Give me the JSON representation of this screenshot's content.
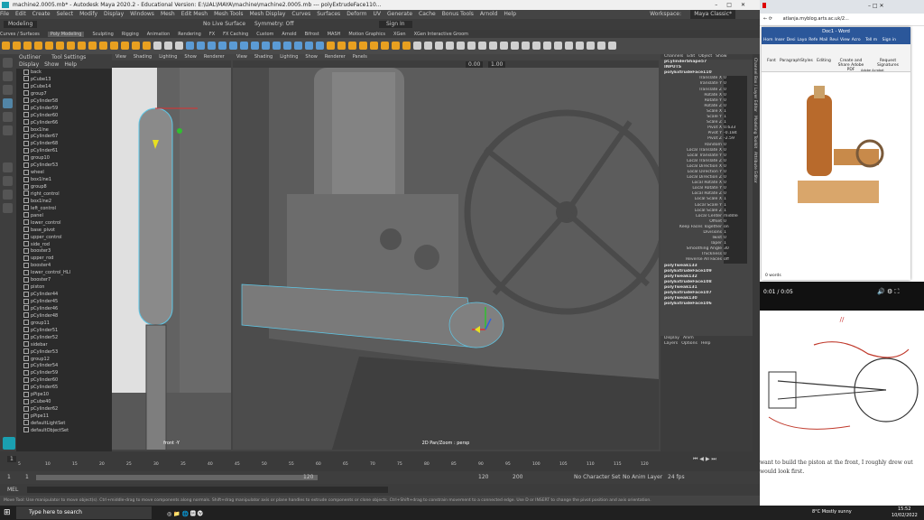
{
  "maya": {
    "title": "machine2.0005.mb* - Autodesk Maya 2020.2 - Educational Version: E:\\UAL\\MAYA\\machine\\machine2.0005.mb --- polyExtrudeFace110...",
    "menus": [
      "File",
      "Edit",
      "Create",
      "Select",
      "Modify",
      "Display",
      "Windows",
      "Mesh",
      "Edit Mesh",
      "Mesh Tools",
      "Mesh Display",
      "Curves",
      "Surfaces",
      "Deform",
      "UV",
      "Generate",
      "Cache",
      "Bonus Tools",
      "Arnold",
      "Help"
    ],
    "workspace_label": "Workspace:",
    "workspace_value": "Maya Classic*",
    "mode": "Modeling",
    "no_live_surface": "No Live Surface",
    "symmetry": "Symmetry: Off",
    "sign_in": "Sign In",
    "shelf_tabs": [
      "Curves / Surfaces",
      "Poly Modeling",
      "Sculpting",
      "Rigging",
      "Animation",
      "Rendering",
      "FX",
      "FX Caching",
      "Custom",
      "Arnold",
      "Bifrost",
      "MASH",
      "Motion Graphics",
      "XGen",
      "XGen Interactive Groom"
    ],
    "outliner": {
      "title": "Outliner",
      "tab2": "Tool Settings",
      "menu": [
        "Display",
        "Show",
        "Help"
      ],
      "items": [
        "back",
        "pCube13",
        "pCube14",
        "group7",
        "pCylinder58",
        "pCylinder59",
        "pCylinder60",
        "pCylinder66",
        "box1lne",
        "pCylinder67",
        "pCylinder68",
        "pCylinder61",
        "group10",
        "pCylinder53",
        "wheel",
        "box1lne1",
        "group8",
        "right_control",
        "box1lne2",
        "left_control",
        "panel",
        "lower_control",
        "base_pivot",
        "upper_control",
        "side_rod",
        "booster3",
        "upper_rod",
        "booster4",
        "lower_control_HLI",
        "booster7",
        "piston",
        "pCylinder44",
        "pCylinder45",
        "pCylinder46",
        "pCylinder48",
        "group11",
        "pCylinder51",
        "pCylinder52",
        "sidebar",
        "pCylinder53",
        "group12",
        "pCylinder54",
        "pCylinder59",
        "pCylinder60",
        "pCylinder65",
        "pPipe10",
        "pCube40",
        "pCylinder62",
        "pPipe11",
        "defaultLightSet",
        "defaultObjectSet"
      ]
    },
    "viewport_menu": [
      "View",
      "Shading",
      "Lighting",
      "Show",
      "Renderer",
      "Panels"
    ],
    "vp1_label": "front -Y",
    "vp2_label": "2D Pan/Zoom : persp",
    "vp2_values": [
      "0.00",
      "1.00"
    ],
    "channel_box": {
      "menu": [
        "Channels",
        "Edit",
        "Object",
        "Show"
      ],
      "object": "pCylinderShape57",
      "inputs_label": "INPUTS",
      "inputs_node": "polyExtrudeFace110",
      "attrs": [
        {
          "label": "Translate X",
          "value": "0"
        },
        {
          "label": "Translate Y",
          "value": "0"
        },
        {
          "label": "Translate Z",
          "value": "0"
        },
        {
          "label": "Rotate X",
          "value": "0"
        },
        {
          "label": "Rotate Y",
          "value": "0"
        },
        {
          "label": "Rotate Z",
          "value": "0"
        },
        {
          "label": "Scale X",
          "value": "1"
        },
        {
          "label": "Scale Y",
          "value": "1"
        },
        {
          "label": "Scale Z",
          "value": "1"
        },
        {
          "label": "Pivot X",
          "value": "0.633"
        },
        {
          "label": "Pivot Y",
          "value": "-0.184"
        },
        {
          "label": "Pivot Z",
          "value": "-2.59"
        },
        {
          "label": "Random",
          "value": "0"
        },
        {
          "label": "Local Translate X",
          "value": "0"
        },
        {
          "label": "Local Translate Y",
          "value": "0"
        },
        {
          "label": "Local Translate Z",
          "value": "0"
        },
        {
          "label": "Local Direction X",
          "value": "0"
        },
        {
          "label": "Local Direction Y",
          "value": "0"
        },
        {
          "label": "Local Direction Z",
          "value": "0"
        },
        {
          "label": "Local Rotate X",
          "value": "0"
        },
        {
          "label": "Local Rotate Y",
          "value": "0"
        },
        {
          "label": "Local Rotate Z",
          "value": "0"
        },
        {
          "label": "Local Scale X",
          "value": "1"
        },
        {
          "label": "Local Scale Y",
          "value": "1"
        },
        {
          "label": "Local Scale Z",
          "value": "1"
        },
        {
          "label": "Local Center",
          "value": "middle"
        },
        {
          "label": "Offset",
          "value": "0"
        },
        {
          "label": "Keep Faces Together",
          "value": "on"
        },
        {
          "label": "Divisions",
          "value": "1"
        },
        {
          "label": "Twist",
          "value": "0"
        },
        {
          "label": "Taper",
          "value": "1"
        },
        {
          "label": "Smoothing Angle",
          "value": "30"
        },
        {
          "label": "Thickness",
          "value": "0"
        },
        {
          "label": "Reverse All Faces",
          "value": "off"
        }
      ],
      "history": [
        "polyTweak133",
        "polyExtrudeFace109",
        "polyTweak132",
        "polyExtrudeFace108",
        "polyTweak131",
        "polyExtrudeFace107",
        "polyTweak130",
        "polyExtrudeFace106"
      ],
      "layers_tabs": [
        "Display",
        "Anim"
      ],
      "layers_menu": [
        "Layers",
        "Options",
        "Help"
      ]
    },
    "side_tabs": [
      "Channel Box / Layer Editor",
      "Modeling Toolkit",
      "Attribute Editor"
    ],
    "timeline_ticks": [
      "5",
      "10",
      "15",
      "20",
      "25",
      "30",
      "35",
      "40",
      "45",
      "50",
      "55",
      "60",
      "65",
      "70",
      "75",
      "80",
      "85",
      "90",
      "95",
      "100",
      "105",
      "110",
      "115",
      "120"
    ],
    "current_frame": "1",
    "range": {
      "start": "1",
      "start2": "1",
      "mid": "120",
      "end": "120",
      "end2": "200",
      "char_set": "No Character Set",
      "anim_layer": "No Anim Layer",
      "fps": "24 fps"
    },
    "mel_label": "MEL",
    "help_line": "Move Tool: Use manipulator to move object(s). Ctrl+middle-drag to move components along normals. Shift+drag manipulator axis or plane handles to extrude components or clone objects. Ctrl+Shift+drag to constrain movement to a connected edge. Use D or INSERT to change the pivot position and axis orientation."
  },
  "browser": {
    "tab_title": "Doc1 - Word",
    "url": "atlanja.myblog.arts.ac.uk/2...",
    "word_tabs": [
      "Hom",
      "Inser",
      "Desi",
      "Layo",
      "Refe",
      "Mail",
      "Revi",
      "View",
      "Acro"
    ],
    "tell_me": "Tell m",
    "sign_in": "Sign in",
    "ribbon_groups": [
      "Font",
      "Paragraph",
      "Styles",
      "Editing",
      "Create and Share Adobe PDF",
      "Request Signatures"
    ],
    "ribbon_caption": "Adobe Acrobat",
    "words": "0 words",
    "zoom_minus": "-",
    "zoom_plus": "+",
    "video_time": "0:01 / 0:05",
    "divider": "//",
    "text": "want to build the piston at the front, I roughly drew out would look first."
  },
  "taskbar": {
    "search_placeholder": "Type here to search",
    "weather": "8°C Mostly sunny",
    "time": "15:52",
    "date": "10/02/2022"
  },
  "colors": {
    "accent_blue": "#5285a6",
    "selection_highlight": "#5ec8e8",
    "manip_x": "#e03030",
    "manip_y": "#30c030",
    "manip_z": "#3060e0",
    "word_blue": "#2b579a"
  }
}
